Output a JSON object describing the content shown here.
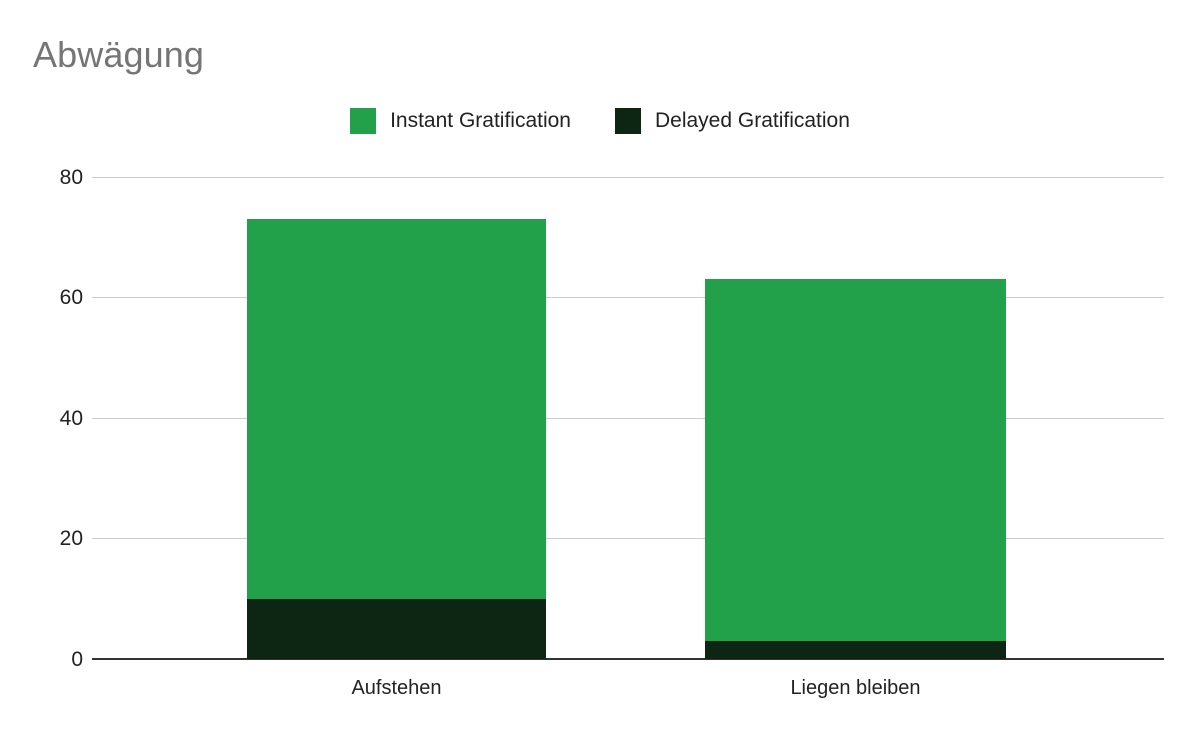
{
  "title": "Abwägung",
  "title_color": "#757575",
  "legend": {
    "position": "top-center",
    "entries": [
      {
        "label": "Instant Gratification",
        "color": "#22a04a"
      },
      {
        "label": "Delayed Gratification",
        "color": "#0c2613"
      }
    ]
  },
  "axis": {
    "y_ticks": [
      "0",
      "20",
      "40",
      "60",
      "80"
    ],
    "x_ticks": [
      "Aufstehen",
      "Liegen bleiben"
    ]
  },
  "chart_data": {
    "type": "bar",
    "stacked": true,
    "title": "Abwägung",
    "xlabel": "",
    "ylabel": "",
    "categories": [
      "Aufstehen",
      "Liegen bleiben"
    ],
    "series": [
      {
        "name": "Delayed Gratification",
        "color": "#0c2613",
        "values": [
          10,
          3
        ]
      },
      {
        "name": "Instant Gratification",
        "color": "#22a04a",
        "values": [
          63,
          60
        ]
      }
    ],
    "stack_totals": [
      73,
      63
    ],
    "ylim": [
      0,
      80
    ],
    "yticks": [
      0,
      20,
      40,
      60,
      80
    ],
    "grid": true,
    "legend_position": "top-center"
  }
}
